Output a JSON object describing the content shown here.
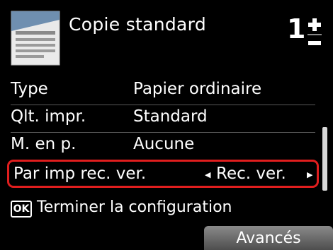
{
  "header": {
    "title": "Copie standard",
    "copies": "1",
    "stepper_plus": "+",
    "stepper_minus": "−"
  },
  "settings": [
    {
      "label": "Type",
      "value": "Papier ordinaire"
    },
    {
      "label": "Qlt. impr.",
      "value": "Standard"
    },
    {
      "label": "M. en p.",
      "value": "Aucune"
    }
  ],
  "selected_setting": {
    "label": "Par imp rec. ver.",
    "value": "Rec. ver.",
    "left_arrow": "◀",
    "right_arrow": "▶"
  },
  "footer": {
    "ok_key": "OK",
    "ok_hint": "Terminer la configuration",
    "advanced_button": "Avancés"
  },
  "colors": {
    "background": "#000000",
    "text": "#ffffff",
    "highlight_border": "#e01e1e"
  },
  "icons": {
    "document": "document-icon",
    "stepper": "plus-minus-icon"
  }
}
